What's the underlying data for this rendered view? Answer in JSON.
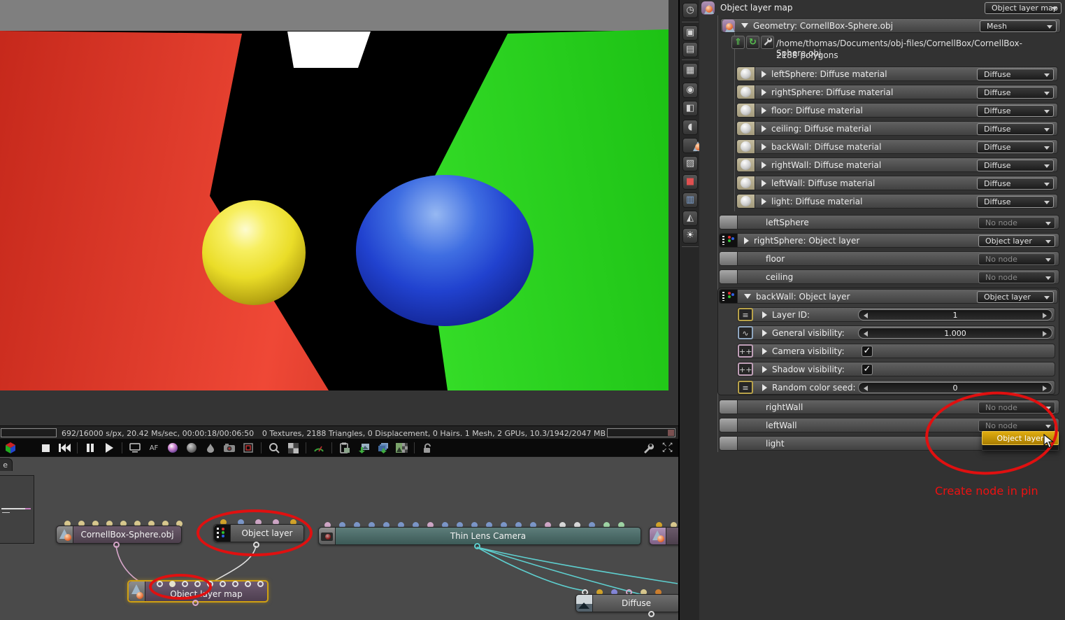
{
  "colors": {
    "accent_gold": "#c79100",
    "annotation_red": "#e01010",
    "selected_node_border": "#cfa012"
  },
  "render": {
    "status_left": "692/16000 s/px, 20.42 Ms/sec, 00:00:18/00:06:50",
    "status_right": "0 Textures, 2188 Triangles, 0 Displacement, 0 Hairs. 1 Mesh, 2 GPUs, 10.3/1942/2047 MB"
  },
  "toolbar": {
    "af_label": "AF"
  },
  "graph": {
    "tab_label": "e",
    "nodes": {
      "mesh": {
        "label": "CornellBox-Sphere.obj",
        "pins": [
          "tan",
          "tan",
          "tan",
          "tan",
          "tan",
          "tan",
          "tan",
          "tan",
          "tan"
        ]
      },
      "objlayer": {
        "label": "Object layer",
        "pins": [
          "gold",
          "blue",
          "pink",
          "pink",
          "gold"
        ]
      },
      "camera": {
        "label": "Thin Lens Camera",
        "pins": [
          "pink",
          "blue",
          "blue",
          "blue",
          "blue",
          "blue",
          "blue",
          "pink",
          "blue",
          "blue",
          "blue",
          "blue",
          "blue",
          "blue",
          "blue",
          "pink",
          "grey",
          "grey",
          "blue",
          "green",
          "green"
        ]
      },
      "map": {
        "label": "Object layer map",
        "pins": [
          "hollow",
          "solid",
          "hollow",
          "hollow",
          "hollow",
          "hollow",
          "hollow",
          "hollow",
          "hollow"
        ]
      },
      "diffuse": {
        "label": "Diffuse",
        "pins": [
          "hollow",
          "gold",
          "indigo",
          "hollowpink",
          "tan",
          "orange"
        ]
      },
      "partial": {
        "pins": [
          "gold",
          "tan"
        ]
      }
    }
  },
  "inspector": {
    "header": {
      "title": "Object layer map",
      "type": "Object layer map"
    },
    "geometry": {
      "title": "Geometry: CornellBox-Sphere.obj",
      "type": "Mesh",
      "path": "/home/thomas/Documents/obj-files/CornellBox/CornellBox-Sphere.obj",
      "polygons": "2188 polygons",
      "materials": [
        {
          "label": "leftSphere: Diffuse material",
          "type": "Diffuse"
        },
        {
          "label": "rightSphere: Diffuse material",
          "type": "Diffuse"
        },
        {
          "label": "floor: Diffuse material",
          "type": "Diffuse"
        },
        {
          "label": "ceiling: Diffuse material",
          "type": "Diffuse"
        },
        {
          "label": "backWall: Diffuse material",
          "type": "Diffuse"
        },
        {
          "label": "rightWall: Diffuse material",
          "type": "Diffuse"
        },
        {
          "label": "leftWall: Diffuse material",
          "type": "Diffuse"
        },
        {
          "label": "light: Diffuse material",
          "type": "Diffuse"
        }
      ]
    },
    "layers": [
      {
        "label": "leftSphere",
        "type": "No node"
      },
      {
        "label": "rightSphere: Object layer",
        "type": "Object layer"
      },
      {
        "label": "floor",
        "type": "No node"
      },
      {
        "label": "ceiling",
        "type": "No node"
      }
    ],
    "backwall": {
      "title": "backWall: Object layer",
      "type": "Object layer",
      "params": [
        {
          "label": "Layer ID:",
          "value": "1"
        },
        {
          "label": "General visibility:",
          "value": "1.000"
        },
        {
          "label": "Camera visibility:",
          "check": "✓"
        },
        {
          "label": "Shadow visibility:",
          "check": "✓"
        },
        {
          "label": "Random color seed:",
          "value": "0"
        }
      ]
    },
    "layers2": [
      {
        "label": "rightWall",
        "type": "No node"
      },
      {
        "label": "leftWall",
        "type": "No node"
      },
      {
        "label": "light"
      }
    ],
    "menu": {
      "highlighted": "Object layer"
    },
    "annotation": "Create node in pin"
  }
}
